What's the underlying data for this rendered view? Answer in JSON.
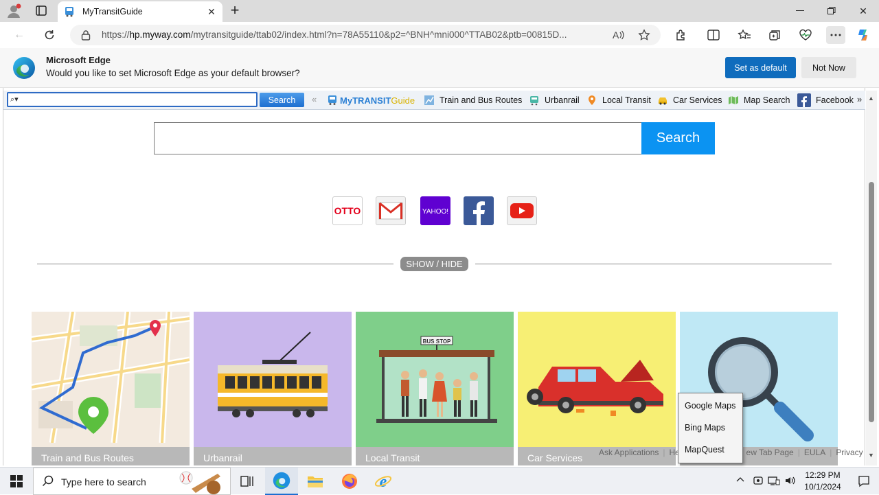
{
  "browser": {
    "tab_title": "MyTransitGuide",
    "url_prefix": "https://",
    "url_host": "hp.myway.com",
    "url_rest": "/mytransitguide/ttab02/index.html?n=78A55110&p2=^BNH^mni000^TTAB02&ptb=00815D..."
  },
  "infobar": {
    "heading": "Microsoft Edge",
    "message": "Would you like to set Microsoft Edge as your default browser?",
    "primary_label": "Set as default",
    "secondary_label": "Not Now"
  },
  "toolbar": {
    "search_button": "Search",
    "logo_my": "My",
    "logo_transit": "TRANSIT",
    "logo_guide": "Guide",
    "links": [
      {
        "label": "Train and Bus Routes",
        "icon": "route-map-icon"
      },
      {
        "label": "Urbanrail",
        "icon": "train-icon"
      },
      {
        "label": "Local Transit",
        "icon": "map-pin-icon"
      },
      {
        "label": "Car Services",
        "icon": "taxi-icon"
      },
      {
        "label": "Map Search",
        "icon": "map-icon"
      },
      {
        "label": "Facebook",
        "icon": "facebook-icon"
      }
    ],
    "more": "»",
    "prev": "«"
  },
  "main": {
    "search_button": "Search",
    "shortcuts": [
      {
        "name": "otto",
        "label": "OTTO"
      },
      {
        "name": "gmail",
        "label": "M"
      },
      {
        "name": "yahoo",
        "label": "YAHOO!"
      },
      {
        "name": "facebook",
        "label": "f"
      },
      {
        "name": "youtube",
        "label": ""
      }
    ],
    "show_hide": "SHOW / HIDE",
    "tiles": [
      {
        "label": "Train and Bus Routes",
        "bg": "#f3eadf"
      },
      {
        "label": "Urbanrail",
        "bg": "#c9b7ec"
      },
      {
        "label": "Local Transit",
        "bg": "#7fcf8a"
      },
      {
        "label": "Car Services",
        "bg": "#f7ef74"
      },
      {
        "label": "",
        "bg": "#bfe8f5"
      }
    ],
    "bus_stop_sign": "BUS STOP"
  },
  "footer": {
    "links": [
      "Ask Applications",
      "He",
      "ew Tab Page",
      "EULA",
      "Privacy"
    ]
  },
  "popup": {
    "items": [
      "Google Maps",
      "Bing Maps",
      "MapQuest"
    ]
  },
  "taskbar": {
    "search_placeholder": "Type here to search",
    "time": "12:29 PM",
    "date": "10/1/2024"
  }
}
